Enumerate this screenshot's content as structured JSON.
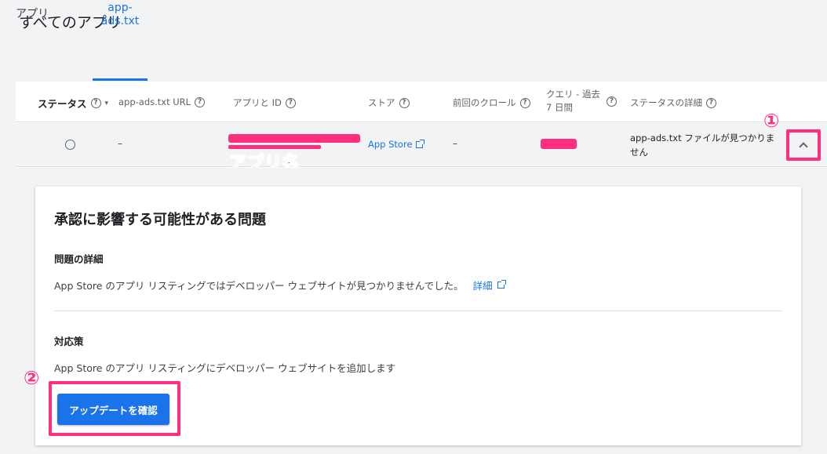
{
  "page": {
    "title": "すべてのアプリ"
  },
  "tabs": [
    {
      "label": "アプリ"
    },
    {
      "label": "app-ads.txt"
    }
  ],
  "table": {
    "headers": {
      "status": "ステータス",
      "url": "app-ads.txt URL",
      "app_id": "アプリと ID",
      "store": "ストア",
      "last_crawl": "前回のクロール",
      "query": "クエリ - 過去 7 日間",
      "status_detail": "ステータスの詳細"
    },
    "help_glyph": "?",
    "sort_glyph": "▾",
    "row": {
      "url": "–",
      "store": "App Store",
      "last_crawl": "–",
      "status_detail": "app-ads.txt ファイルが見つかりません"
    },
    "app_name_annotation": "アプリ名"
  },
  "annotations": {
    "marker_1": "①",
    "marker_2": "②",
    "highlight_color": "#ff2e7e"
  },
  "issue": {
    "title": "承認に影響する可能性がある問題",
    "details_heading": "問題の詳細",
    "details_text": "App Store のアプリ リスティングではデベロッパー ウェブサイトが見つかりませんでした。",
    "learn_more": "詳細",
    "fix_heading": "対応策",
    "fix_text": "App Store のアプリ リスティングにデベロッパー ウェブサイトを追加します",
    "cta": "アップデートを確認"
  },
  "colors": {
    "accent": "#1a73e8",
    "background": "#f1f3f4"
  },
  "icons": {
    "help": "help-circle-icon",
    "external": "open-in-new-icon",
    "expand": "chevron-up-icon"
  }
}
